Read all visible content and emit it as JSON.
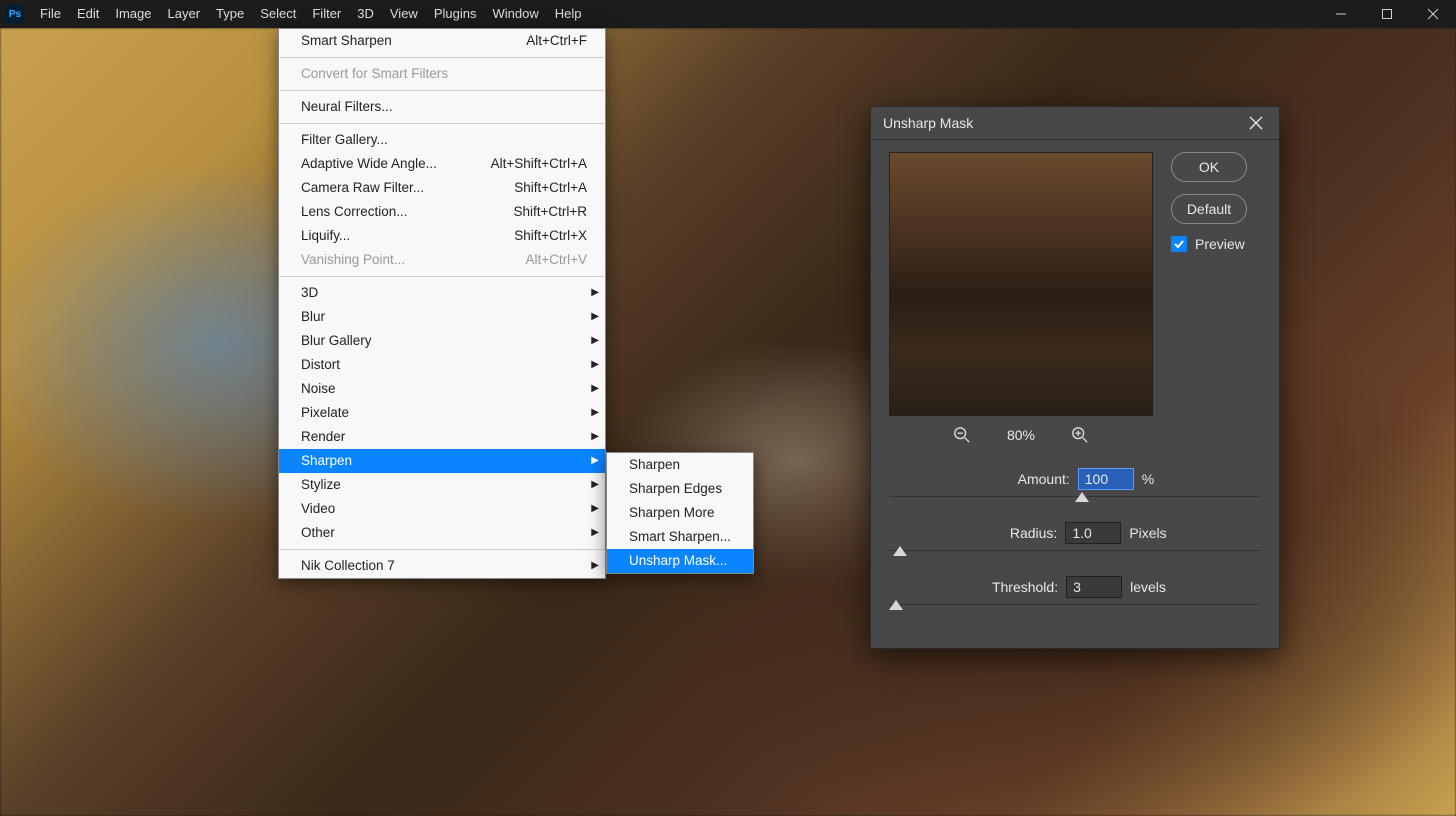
{
  "menubar": {
    "items": [
      "File",
      "Edit",
      "Image",
      "Layer",
      "Type",
      "Select",
      "Filter",
      "3D",
      "View",
      "Plugins",
      "Window",
      "Help"
    ]
  },
  "filter_menu": {
    "last": {
      "label": "Smart Sharpen",
      "shortcut": "Alt+Ctrl+F"
    },
    "convert": "Convert for Smart Filters",
    "neural": "Neural Filters...",
    "gallery": "Filter Gallery...",
    "adaptive": {
      "label": "Adaptive Wide Angle...",
      "shortcut": "Alt+Shift+Ctrl+A"
    },
    "cameraraw": {
      "label": "Camera Raw Filter...",
      "shortcut": "Shift+Ctrl+A"
    },
    "lens": {
      "label": "Lens Correction...",
      "shortcut": "Shift+Ctrl+R"
    },
    "liquify": {
      "label": "Liquify...",
      "shortcut": "Shift+Ctrl+X"
    },
    "vanishing": {
      "label": "Vanishing Point...",
      "shortcut": "Alt+Ctrl+V"
    },
    "subs": [
      "3D",
      "Blur",
      "Blur Gallery",
      "Distort",
      "Noise",
      "Pixelate",
      "Render",
      "Sharpen",
      "Stylize",
      "Video",
      "Other"
    ],
    "nik": "Nik Collection 7"
  },
  "sharpen_submenu": [
    "Sharpen",
    "Sharpen Edges",
    "Sharpen More",
    "Smart Sharpen...",
    "Unsharp Mask..."
  ],
  "dialog": {
    "title": "Unsharp Mask",
    "ok": "OK",
    "default": "Default",
    "preview": "Preview",
    "zoom": "80%",
    "amount": {
      "label": "Amount:",
      "value": "100",
      "unit": "%"
    },
    "radius": {
      "label": "Radius:",
      "value": "1.0",
      "unit": "Pixels"
    },
    "threshold": {
      "label": "Threshold:",
      "value": "3",
      "unit": "levels"
    }
  }
}
